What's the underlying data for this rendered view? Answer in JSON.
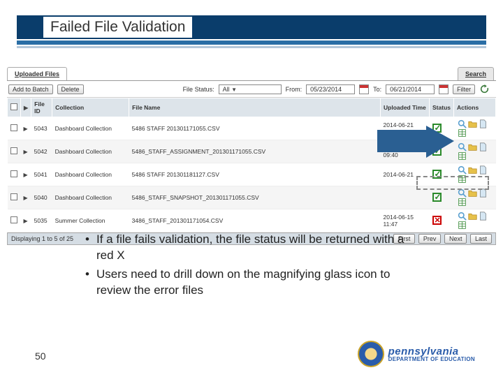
{
  "slide": {
    "title": "Failed File Validation",
    "page_number": "50"
  },
  "tabs": {
    "uploaded": "Uploaded Files",
    "search": "Search"
  },
  "toolbar": {
    "add_batch": "Add to Batch",
    "delete": "Delete",
    "file_status_label": "File Status:",
    "file_status_value": "All",
    "from_label": "From:",
    "from_value": "05/23/2014",
    "to_label": "To:",
    "to_value": "06/21/2014",
    "filter": "Filter"
  },
  "columns": {
    "select": "",
    "chev": "",
    "file_id": "File ID",
    "collection": "Collection",
    "file_name": "File Name",
    "uploaded_time": "Uploaded Time",
    "status": "Status",
    "actions": "Actions"
  },
  "rows": [
    {
      "id": "5043",
      "collection": "Dashboard Collection",
      "file": "5486 STAFF 201301171055.CSV",
      "time": "2014-06-21 09:40",
      "status": "ok"
    },
    {
      "id": "5042",
      "collection": "Dashboard Collection",
      "file": "5486_STAFF_ASSIGNMENT_201301171055.CSV",
      "time": "2014-06-21 09:40",
      "status": "ok"
    },
    {
      "id": "5041",
      "collection": "Dashboard Collection",
      "file": "5486 STAFF 201301181127.CSV",
      "time": "2014-06-21",
      "status": "ok"
    },
    {
      "id": "5040",
      "collection": "Dashboard Collection",
      "file": "5486_STAFF_SNAPSHOT_201301171055.CSV",
      "time": "",
      "status": "ok"
    },
    {
      "id": "5035",
      "collection": "Summer Collection",
      "file": "3486_STAFF_201301171054.CSV",
      "time": "2014-06-15 11:47",
      "status": "bad"
    }
  ],
  "pager": {
    "info": "Displaying 1 to 5 of 25",
    "first": "First",
    "prev": "Prev",
    "next": "Next",
    "last": "Last"
  },
  "bullets": {
    "b1": "If a file fails validation, the file status will be returned with a red X",
    "b2": "Users need to drill down on the magnifying glass icon to review the error files"
  },
  "logo": {
    "state": "pennsylvania",
    "dept": "DEPARTMENT OF EDUCATION"
  }
}
